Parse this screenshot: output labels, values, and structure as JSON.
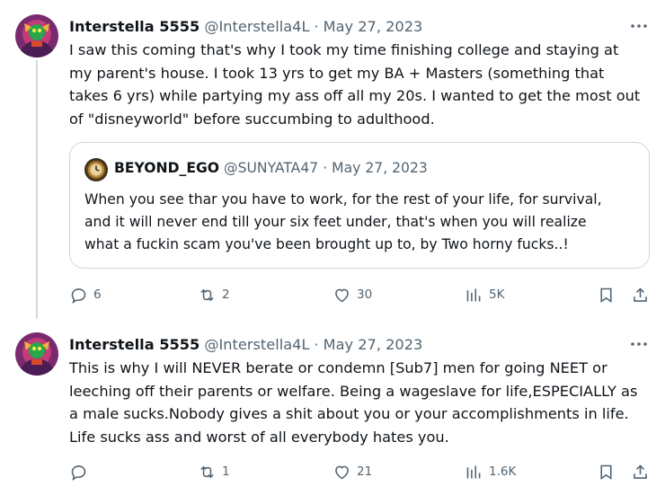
{
  "tweets": [
    {
      "author": {
        "name": "Interstella 5555",
        "handle": "@Interstella4L",
        "avatar": "avatar-image"
      },
      "separator": "·",
      "date": "May 27, 2023",
      "text": "I saw this coming that's why I took my time finishing college and staying at my parent's house. I took 13 yrs to get my BA + Masters (something that takes 6 yrs) while partying my ass off all my 20s. I wanted to get the most out of \"disneyworld\" before succumbing to adulthood.",
      "text_lines": [
        "I saw this coming that's why I took my time finishing college and staying at",
        "my parent's house. I took 13 yrs to get my BA + Masters (something that",
        "takes 6 yrs) while partying my ass off all my 20s. I wanted to get the most out",
        "of \"disneyworld\" before succumbing to adulthood."
      ],
      "quote": {
        "author": {
          "name": "BEYOND_EGO",
          "handle": "@SUNYATA47",
          "avatar": "clock-avatar"
        },
        "separator": "·",
        "date": "May 27, 2023",
        "text_lines": [
          "When you see thar you have to work, for the rest of your life, for survival,",
          "and it will never end till your six feet under, that's when you will realize",
          "what a fuckin scam you've been brought up to, by Two horny fucks..!"
        ]
      },
      "stats": {
        "replies": "6",
        "reposts": "2",
        "likes": "30",
        "views": "5K"
      }
    },
    {
      "author": {
        "name": "Interstella 5555",
        "handle": "@Interstella4L",
        "avatar": "avatar-image"
      },
      "separator": "·",
      "date": "May 27, 2023",
      "text_lines": [
        "This is why I will NEVER berate or condemn [Sub7] men for going NEET or",
        "leeching off their parents or welfare. Being a wageslave for life,ESPECIALLY as",
        "a male sucks.Nobody gives a shit about you or your accomplishments in life.",
        "Life sucks ass and worst of all everybody hates you."
      ],
      "stats": {
        "replies": "",
        "reposts": "1",
        "likes": "21",
        "views": "1.6K"
      }
    }
  ],
  "icons": {
    "reply": "speech-bubble-icon",
    "repost": "repost-arrows-icon",
    "like": "heart-icon",
    "views": "bar-chart-icon",
    "bookmark": "bookmark-icon",
    "share": "share-upload-icon",
    "more": "three-dots-icon"
  },
  "colors": {
    "text": "#0f1419",
    "muted": "#536471",
    "border": "#cfd9de",
    "thread_line": "#cfd9de"
  }
}
